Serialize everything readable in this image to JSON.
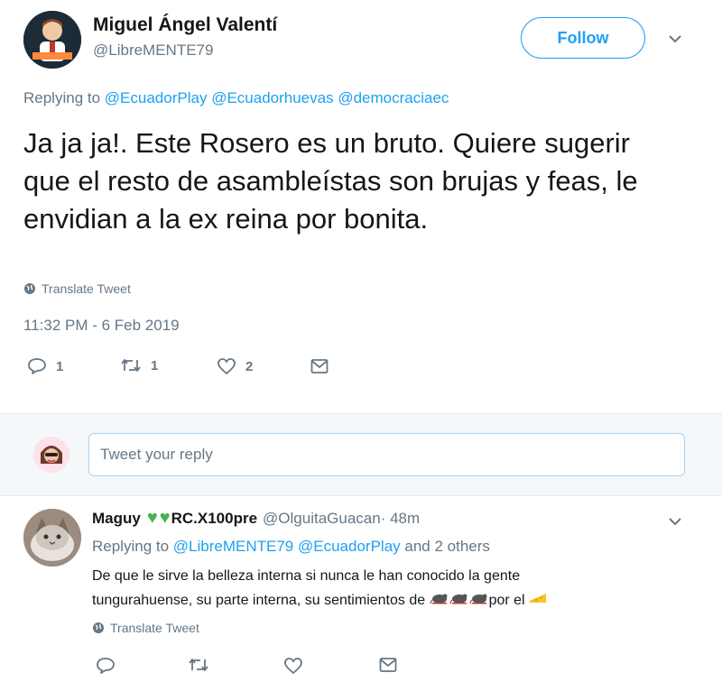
{
  "main_tweet": {
    "author_name": "Miguel Ángel Valentí",
    "author_handle": "@LibreMENTE79",
    "follow_label": "Follow",
    "replying_prefix": "Replying to",
    "mentions": [
      "@EcuadorPlay",
      "@Ecuadorhuevas",
      "@democraciaec"
    ],
    "text": "Ja ja ja!. Este Rosero es un bruto. Quiere sugerir que el resto de asambleístas son brujas y feas, le envidian a la ex reina por bonita.",
    "translate_label": "Translate Tweet",
    "timestamp": "11:32 PM - 6 Feb 2019",
    "counts": {
      "replies": "1",
      "retweets": "1",
      "likes": "2"
    }
  },
  "reply_composer": {
    "placeholder": "Tweet your reply"
  },
  "reply_tweet": {
    "author_name_prefix": "Maguy",
    "author_name_suffix": "RC.X100pre",
    "author_handle": "@OlguitaGuacan",
    "time": " · 48m",
    "replying_prefix": "Replying to",
    "mentions": [
      "@LibreMENTE79",
      "@EcuadorPlay"
    ],
    "others": "and 2 others",
    "text_line1": "De que le sirve la belleza interna si nunca le han conocido la gente",
    "text_line2": "tungurahuense,  su parte interna, su sentimientos de",
    "text_tail": "por el",
    "translate_label": "Translate Tweet"
  },
  "icons": {
    "globe": "globe-icon",
    "reply": "reply-icon",
    "retweet": "retweet-icon",
    "like": "heart-icon",
    "dm": "envelope-icon",
    "caret": "chevron-down-icon",
    "green_heart": "green-heart-emoji",
    "rat": "rat-emoji",
    "cheese": "cheese-emoji"
  },
  "colors": {
    "accent": "#1da1f2",
    "secondary_text": "#657786",
    "text": "#14171a",
    "green_heart": "#4caf50"
  }
}
